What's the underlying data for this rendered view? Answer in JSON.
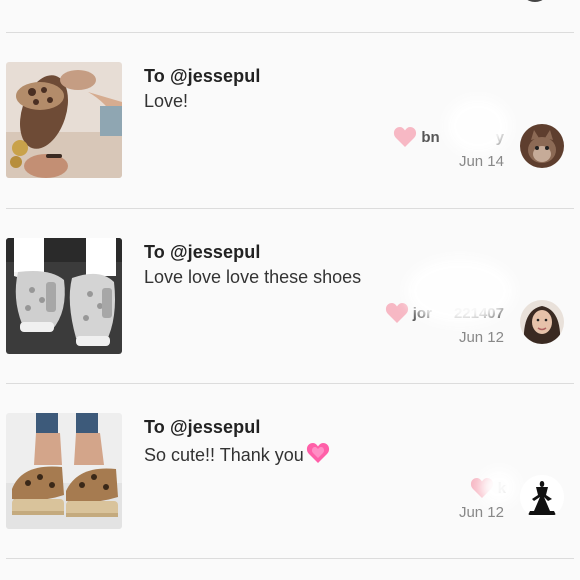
{
  "comments": [
    {
      "to": "To @jessepul",
      "message": "Love!",
      "username": "bn",
      "username_tail": "y",
      "date": "Jun 14",
      "thumb_icon": "leopard-slide-sandal",
      "avatar_icon": "cat-photo"
    },
    {
      "to": "To @jessepul",
      "message": "Love love love these shoes",
      "username": "jor",
      "username_tail": "221407",
      "date": "Jun 12",
      "thumb_icon": "snakeskin-wedge-sneaker",
      "avatar_icon": "user-photo"
    },
    {
      "to": "To @jessepul",
      "message": "So cute!! Thank you",
      "message_emoji": "pink-heart",
      "username": "k",
      "username_tail": "",
      "date": "Jun 12",
      "thumb_icon": "leopard-espadrille-sandal",
      "avatar_icon": "dancer-logo"
    }
  ],
  "colors": {
    "heart": "#f7b8c4",
    "divider": "#dcdcdc",
    "background": "#fafafa"
  }
}
